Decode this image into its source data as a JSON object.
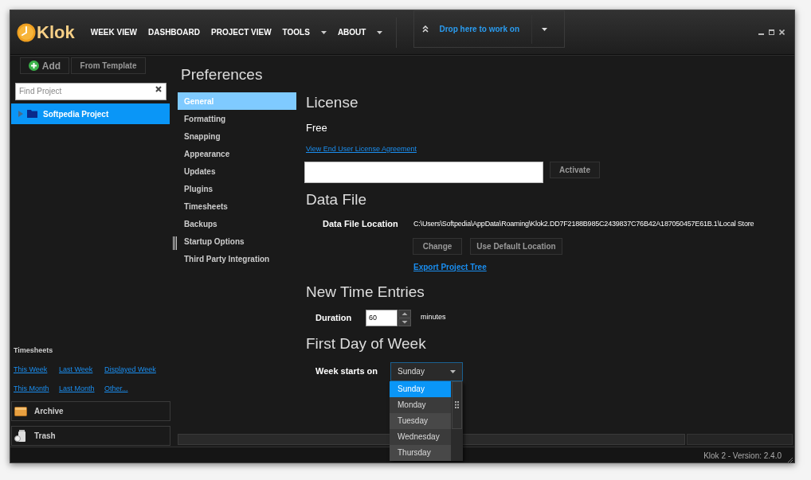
{
  "app": {
    "name": "Klok"
  },
  "nav": [
    {
      "label": "WEEK VIEW",
      "menu": false
    },
    {
      "label": "DASHBOARD",
      "menu": false
    },
    {
      "label": "PROJECT VIEW",
      "menu": false
    },
    {
      "label": "TOOLS",
      "menu": true
    },
    {
      "label": "ABOUT",
      "menu": true
    }
  ],
  "drop_zone": {
    "label": "Drop here to work on"
  },
  "sidebar": {
    "add_button": "Add",
    "template_button": "From Template",
    "search": {
      "placeholder": "Find Project"
    },
    "projects": [
      {
        "name": "Softpedia Project",
        "selected": true,
        "expanded": false
      }
    ],
    "timesheets": {
      "title": "Timesheets",
      "links": [
        [
          "This Week",
          "Last Week",
          "Displayed Week"
        ],
        [
          "This Month",
          "Last Month",
          "Other..."
        ]
      ]
    },
    "bins": [
      {
        "kind": "archive",
        "label": "Archive"
      },
      {
        "kind": "trash",
        "label": "Trash"
      }
    ]
  },
  "preferences": {
    "title": "Preferences",
    "sections": [
      {
        "label": "General",
        "selected": true
      },
      {
        "label": "Formatting",
        "selected": false
      },
      {
        "label": "Snapping",
        "selected": false
      },
      {
        "label": "Appearance",
        "selected": false
      },
      {
        "label": "Updates",
        "selected": false
      },
      {
        "label": "Plugins",
        "selected": false
      },
      {
        "label": "Timesheets",
        "selected": false
      },
      {
        "label": "Backups",
        "selected": false
      },
      {
        "label": "Startup Options",
        "selected": false
      },
      {
        "label": "Third Party Integration",
        "selected": false
      }
    ]
  },
  "license": {
    "heading": "License",
    "type": "Free",
    "eula_link": "View End User License Agreement",
    "activate_button": "Activate"
  },
  "data_file": {
    "heading": "Data File",
    "label": "Data File Location",
    "path": "C:\\Users\\Softpedia\\AppData\\Roaming\\Klok2.DD7F2188B985C2439837C76B42A187050457E61B.1\\Local Store",
    "buttons": [
      "Change",
      "Use Default Location"
    ],
    "export_link": "Export Project Tree"
  },
  "time_entries": {
    "heading": "New Time Entries",
    "label": "Duration",
    "value": "60",
    "unit": "minutes"
  },
  "first_day": {
    "heading": "First Day of Week",
    "label": "Week starts on",
    "value": "Sunday",
    "expanded": true,
    "options": [
      {
        "label": "Sunday",
        "selected": true
      },
      {
        "label": "Monday",
        "selected": false
      },
      {
        "label": "Tuesday",
        "selected": false
      },
      {
        "label": "Wednesday",
        "selected": false
      },
      {
        "label": "Thursday",
        "selected": false
      }
    ]
  },
  "status_bar": {
    "version": "Klok 2 - Version: 2.4.0"
  }
}
